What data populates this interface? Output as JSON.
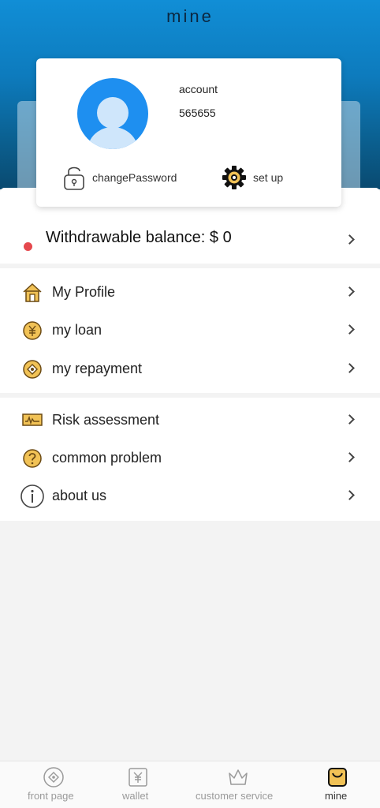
{
  "header": {
    "title": "mine"
  },
  "account": {
    "label": "account",
    "value": "565655",
    "change_password_label": "changePassword",
    "setup_label": "set up"
  },
  "balance": {
    "label": "Withdrawable balance: $ 0"
  },
  "menu_primary": [
    {
      "label": "My Profile",
      "icon": "house-icon"
    },
    {
      "label": "my loan",
      "icon": "yen-coin-icon"
    },
    {
      "label": "my repayment",
      "icon": "diamond-coin-icon"
    }
  ],
  "menu_secondary": [
    {
      "label": "Risk assessment",
      "icon": "chart-card-icon"
    },
    {
      "label": "common problem",
      "icon": "question-circle-icon"
    },
    {
      "label": "about us",
      "icon": "info-circle-icon"
    }
  ],
  "tabbar": [
    {
      "label": "front page",
      "icon": "compass-icon",
      "active": false
    },
    {
      "label": "wallet",
      "icon": "yen-wallet-icon",
      "active": false
    },
    {
      "label": "customer service",
      "icon": "crown-icon",
      "active": false
    },
    {
      "label": "mine",
      "icon": "user-tab-icon",
      "active": true
    }
  ],
  "colors": {
    "header_top": "#118ed6",
    "header_bottom": "#0a4a70",
    "avatar": "#1e8ff0",
    "status_dot": "#e5484d",
    "icon_gold": "#f1c256"
  }
}
